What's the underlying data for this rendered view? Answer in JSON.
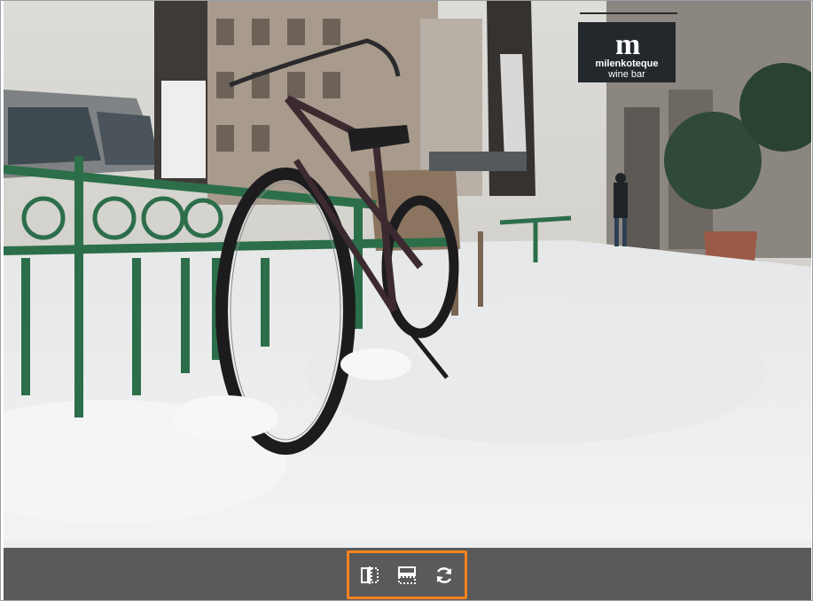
{
  "photo": {
    "sign_logo": "m",
    "sign_line1": "milenkoteque",
    "sign_line2": "wine bar"
  },
  "toolbar": {
    "buttons": [
      {
        "icon": "flip-horizontal-icon"
      },
      {
        "icon": "flip-vertical-icon"
      },
      {
        "icon": "rotate-icon"
      }
    ],
    "highlight_color": "#f5821f",
    "background_color": "#5a5a5a"
  }
}
